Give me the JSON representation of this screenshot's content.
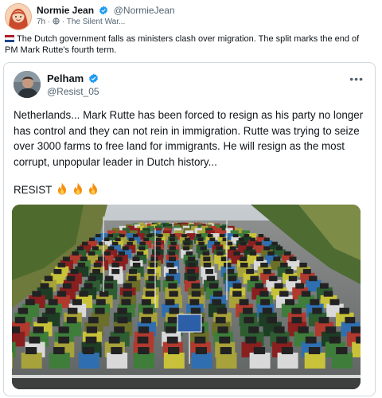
{
  "outer_post": {
    "author_name": "Normie Jean",
    "author_handle": "@NormieJean",
    "time": "7h",
    "channel": "The Silent War...",
    "text": "The Dutch government falls as ministers clash over migration. The split marks the end of PM Mark Rutte's fourth term.",
    "flag_icon": "netherlands-flag-icon"
  },
  "quoted_post": {
    "author_name": "Pelham",
    "author_handle": "@Resist_05",
    "more_label": "•••",
    "text": "Netherlands... Mark Rutte has been forced to resign as his party no longer has control and they can not rein in immigration. Rutte was trying to seize over 3000 farms to free land for immigrants. He will resign as the most corrupt, unpopular leader in Dutch history...",
    "resist_text": "RESIST",
    "fire_icons": [
      "fire-icon",
      "fire-icon",
      "fire-icon"
    ]
  },
  "colors": {
    "verified": "#1d9bf0",
    "text": "#0f1419",
    "muted": "#536471",
    "border": "#cfd9de"
  }
}
